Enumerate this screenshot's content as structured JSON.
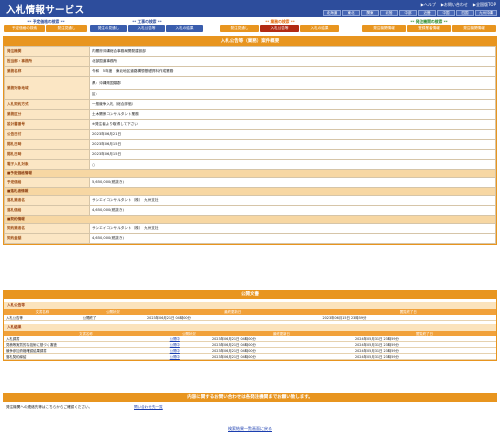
{
  "header": {
    "title": "入札情報サービス",
    "util_links": [
      "▶ヘルプ",
      "▶お問い合わせ",
      "▶全国版TOP"
    ],
    "regions": [
      "北海道",
      "東北",
      "関東",
      "北陸",
      "中部",
      "近畿",
      "中国",
      "四国",
      "九州沖縄"
    ]
  },
  "nav": {
    "groups": [
      {
        "head": "** 予定価格の検索 **",
        "buttons": [
          "予定価格の検索",
          "発注見通し"
        ]
      },
      {
        "head": "** 工事の検索 **",
        "buttons": [
          "発注の見通し",
          "入札公告等",
          "入札の結果"
        ]
      },
      {
        "head": "** 業務の検索 **",
        "buttons": [
          "発注見通し",
          "入札公告等",
          "入札の結果"
        ],
        "active": 1
      },
      {
        "head": "** 発注機関の検索 **",
        "buttons": [
          "発注機関情報",
          "登録業者情報",
          "発注機関情報"
        ]
      }
    ]
  },
  "detail": {
    "title": "入札公告等（業務）案件概要",
    "rows": [
      {
        "k": "発注機関",
        "v": "内閣府沖縄総合事務局開発建設部"
      },
      {
        "k": "担当部・事務所",
        "v": "北部国道事務所"
      },
      {
        "k": "業務名称",
        "v": "令和　5年度　東北地区道路構想基礎資料作成業務"
      },
      {
        "k": "業務対象地域",
        "v": "県：沖縄県国頭郡",
        "v2": "区："
      },
      {
        "k": "入札契約方式",
        "v": "一般競争入札（総合評価）"
      },
      {
        "k": "業務区分",
        "v": "土木関係コンサルタント業務"
      },
      {
        "k": "設計書番号",
        "v": "※発注者より取得して下さい"
      },
      {
        "k": "公告日付",
        "v": "2023年06月21日"
      },
      {
        "k": "開札日時",
        "v": "2023年06月15日"
      },
      {
        "k": "開札日時",
        "v": "2023年06月15日"
      },
      {
        "k": "電子入札対象",
        "v": "○"
      }
    ],
    "sub1": "■予定価格情報",
    "rows2": [
      {
        "k": "予定価格",
        "v": "5,650,000(税抜き)"
      }
    ],
    "sub2": "■落札者情報",
    "rows3": [
      {
        "k": "落札業者名",
        "v": "サンエイコンサルタント（株）　九州支社"
      },
      {
        "k": "落札価格",
        "v": "4,650,000(税抜き)"
      }
    ],
    "sub3": "■契約情報",
    "rows4": [
      {
        "k": "契約業者名",
        "v": "サンエイコンサルタント（株）　九州支社"
      },
      {
        "k": "契約金額",
        "v": "4,650,000(税抜き)"
      }
    ]
  },
  "docs": {
    "title": "公開文書",
    "cat1": "入札公告等",
    "cat2": "入札結果",
    "headers": [
      "文書名称",
      "公開状況",
      "最終更新日",
      "閲覧終了日"
    ],
    "rows1": [
      {
        "name": "入札公告等",
        "status": "公開終了",
        "updated": "2023年06月21日 04時00分",
        "end": "2023年06月15日 23時59分"
      }
    ],
    "rows2": [
      {
        "name": "入札調書",
        "status": "公開中",
        "updated": "2023年06月21日 04時00分",
        "end": "2024年05月31日 23時59分"
      },
      {
        "name": "見積等実質的な技術に基づく審査",
        "status": "公開中",
        "updated": "2023年06月21日 04時00分",
        "end": "2024年05月31日 23時59分"
      },
      {
        "name": "競争参加資格確認結果調書",
        "status": "公開中",
        "updated": "2023年06月21日 04時00分",
        "end": "2024年05月31日 23時59分"
      },
      {
        "name": "落札契約締結",
        "status": "公開中",
        "updated": "2023年06月21日 04時00分",
        "end": "2024年05月31日 23時59分"
      }
    ]
  },
  "inquiry": {
    "title": "内容に関するお問い合わせは各発注機関までお願い致します。",
    "text": "発注機関への連絡先等はこちらからご確認ください。",
    "link": "問い合わせ先一覧"
  },
  "back": "検索結果一覧画面に戻る"
}
